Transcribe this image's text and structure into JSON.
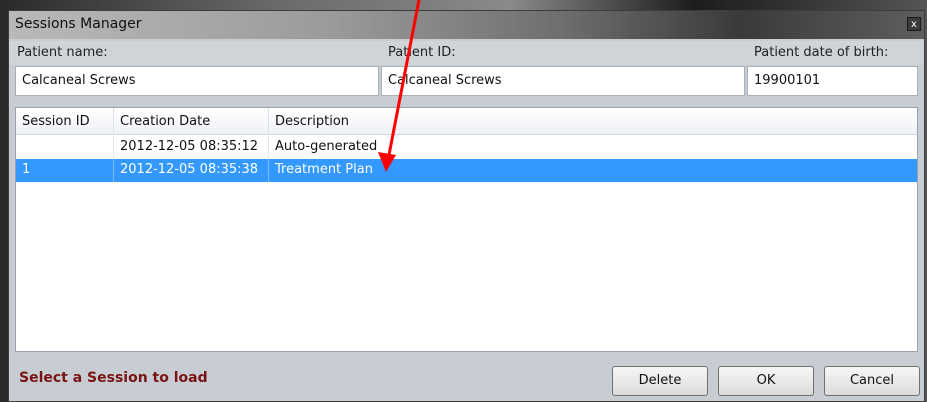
{
  "window": {
    "title": "Sessions Manager",
    "close_glyph": "x"
  },
  "patient": {
    "name_label": "Patient name:",
    "id_label": "Patient ID:",
    "dob_label": "Patient date of birth:",
    "name_value": "Calcaneal Screws",
    "id_value": "Calcaneal Screws",
    "dob_value": "19900101"
  },
  "table": {
    "columns": [
      "Session ID",
      "Creation Date",
      "Description"
    ],
    "rows": [
      {
        "session_id": "",
        "creation_date": "2012-12-05 08:35:12",
        "description": "Auto-generated",
        "selected": false
      },
      {
        "session_id": "1",
        "creation_date": "2012-12-05 08:35:38",
        "description": "Treatment Plan",
        "selected": true
      }
    ]
  },
  "footer": {
    "status": "Select a Session to load",
    "delete_label": "Delete",
    "ok_label": "OK",
    "cancel_label": "Cancel"
  },
  "colors": {
    "selection": "#3399ff",
    "status_text": "#7a1414",
    "annotation_arrow": "#ff0000"
  }
}
